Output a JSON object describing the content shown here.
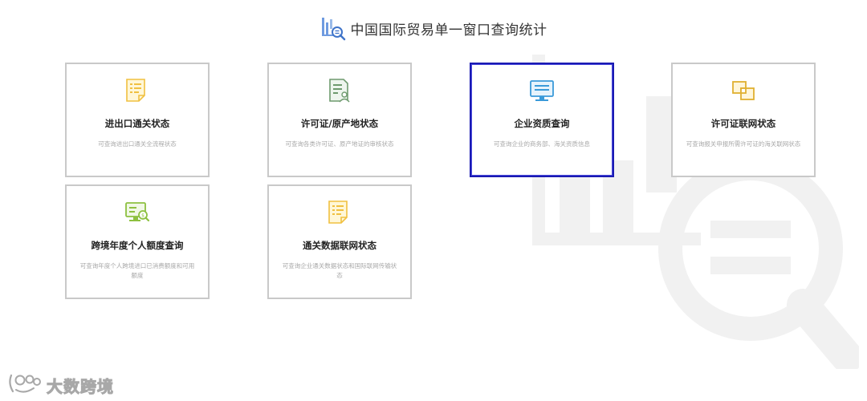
{
  "header": {
    "title": "中国国际贸易单一窗口查询统计",
    "icon": "bar-chart-search-icon"
  },
  "cards": [
    {
      "title": "进出口通关状态",
      "description": "可查询进出口通关全流程状态",
      "icon": "document-list-icon",
      "color": "#f0c040"
    },
    {
      "title": "许可证/原产地状态",
      "description": "可查询各类许可证、原产地证的审核状态",
      "icon": "certificate-user-icon",
      "color": "#6e9a6e"
    },
    {
      "title": "企业资质查询",
      "description": "可查询企业的商务部、海关资质信息",
      "icon": "monitor-icon",
      "color": "#3a9ad9",
      "selected": true
    },
    {
      "title": "许可证联网状态",
      "description": "可查询报关申报所需许可证的海关联网状态",
      "icon": "linked-squares-icon",
      "color": "#e0b030"
    },
    {
      "title": "跨境年度个人额度查询",
      "description": "可查询年度个人跨境进口已消费额度和可用额度",
      "icon": "monitor-search-icon",
      "color": "#8dc040"
    },
    {
      "title": "通关数据联网状态",
      "description": "可查询企业通关数据状态和国际联网传输状态",
      "icon": "document-list-icon",
      "color": "#f0c040"
    }
  ],
  "footer": {
    "brand": "大数跨境",
    "icon": "brand-logo-icon"
  },
  "colors": {
    "accent": "#1a1ab2",
    "border": "#c9c9c9",
    "watermark": "#f0f0f0"
  }
}
